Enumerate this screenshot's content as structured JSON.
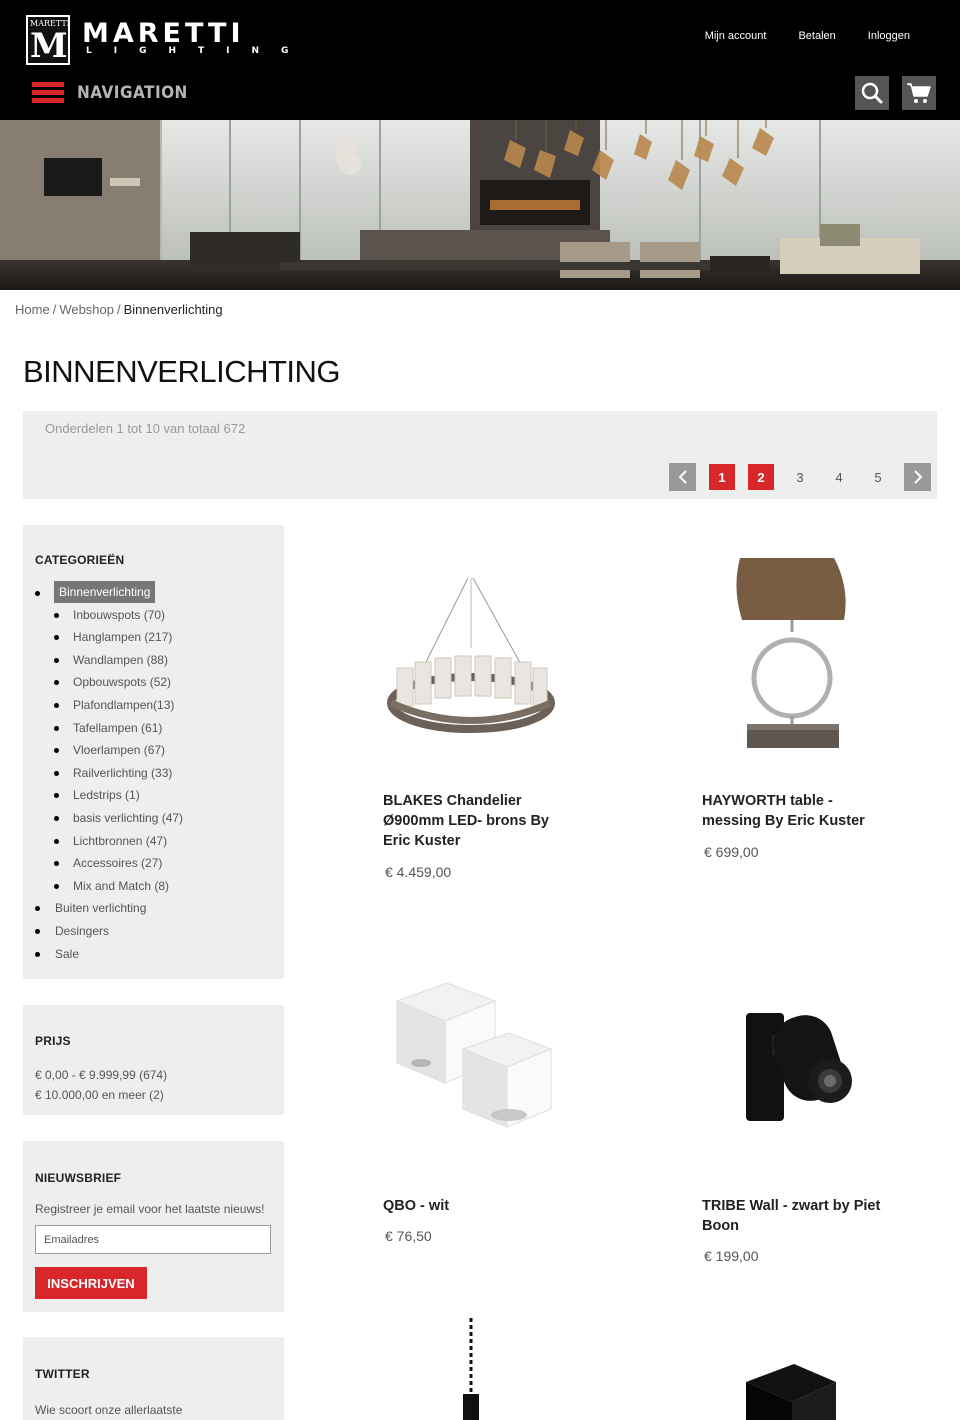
{
  "header": {
    "brand": "MARETTI",
    "brand_sub": "LIGHTING",
    "badge_text": "MARETTI",
    "badge_letter": "M",
    "links": [
      "Mijn account",
      "Betalen",
      "Inloggen"
    ],
    "nav_label": "NAVIGATION",
    "icons": [
      "search-icon",
      "cart-icon"
    ],
    "accent": "#d9262b"
  },
  "breadcrumb": {
    "home": "Home",
    "shop": "Webshop",
    "current": "Binnenverlichting",
    "separator": "/"
  },
  "page_title": "BINNENVERLICHTING",
  "toolbar": {
    "count_text": "Onderdelen 1 tot 10 van totaal 672",
    "pages": [
      "1",
      "2",
      "3",
      "4",
      "5"
    ],
    "active_pages": [
      "1",
      "2"
    ]
  },
  "sidebar": {
    "categories_title": "CATEGORIEËN",
    "active_category": "Binnenverlichting",
    "subcategories": [
      "Inbouwspots (70)",
      "Hanglampen (217)",
      "Wandlampen (88)",
      "Opbouwspots (52)",
      "Plafondlampen(13)",
      "Tafellampen (61)",
      "Vloerlampen (67)",
      "Railverlichting (33)",
      "Ledstrips (1)",
      "basis verlichting (47)",
      "Lichtbronnen (47)",
      "Accessoires (27)",
      "Mix and Match (8)"
    ],
    "other_categories": [
      "Buiten verlichting",
      "Desingers",
      "Sale"
    ],
    "price_title": "PRIJS",
    "price_ranges": [
      "€ 0,00 - € 9.999,99 (674)",
      "€ 10.000,00 en meer (2)"
    ],
    "newsletter_title": "NIEUWSBRIEF",
    "newsletter_text": "Registreer je email voor het laatste nieuws!",
    "newsletter_placeholder": "Emailadres",
    "newsletter_button": "INSCHRIJVEN",
    "twitter_title": "TWITTER",
    "twitter_text": "Wie scoort onze allerlaatste"
  },
  "products": [
    {
      "name": "BLAKES Chandelier Ø900mm LED- brons By Eric Kuster",
      "price": "€ 4.459,00"
    },
    {
      "name": "HAYWORTH table - messing By Eric Kuster",
      "price": "€ 699,00"
    },
    {
      "name": "QBO - wit",
      "price": "€ 76,50"
    },
    {
      "name": "TRIBE Wall - zwart by Piet Boon",
      "price": "€ 199,00"
    },
    {
      "name": "",
      "price": ""
    },
    {
      "name": "",
      "price": ""
    }
  ]
}
